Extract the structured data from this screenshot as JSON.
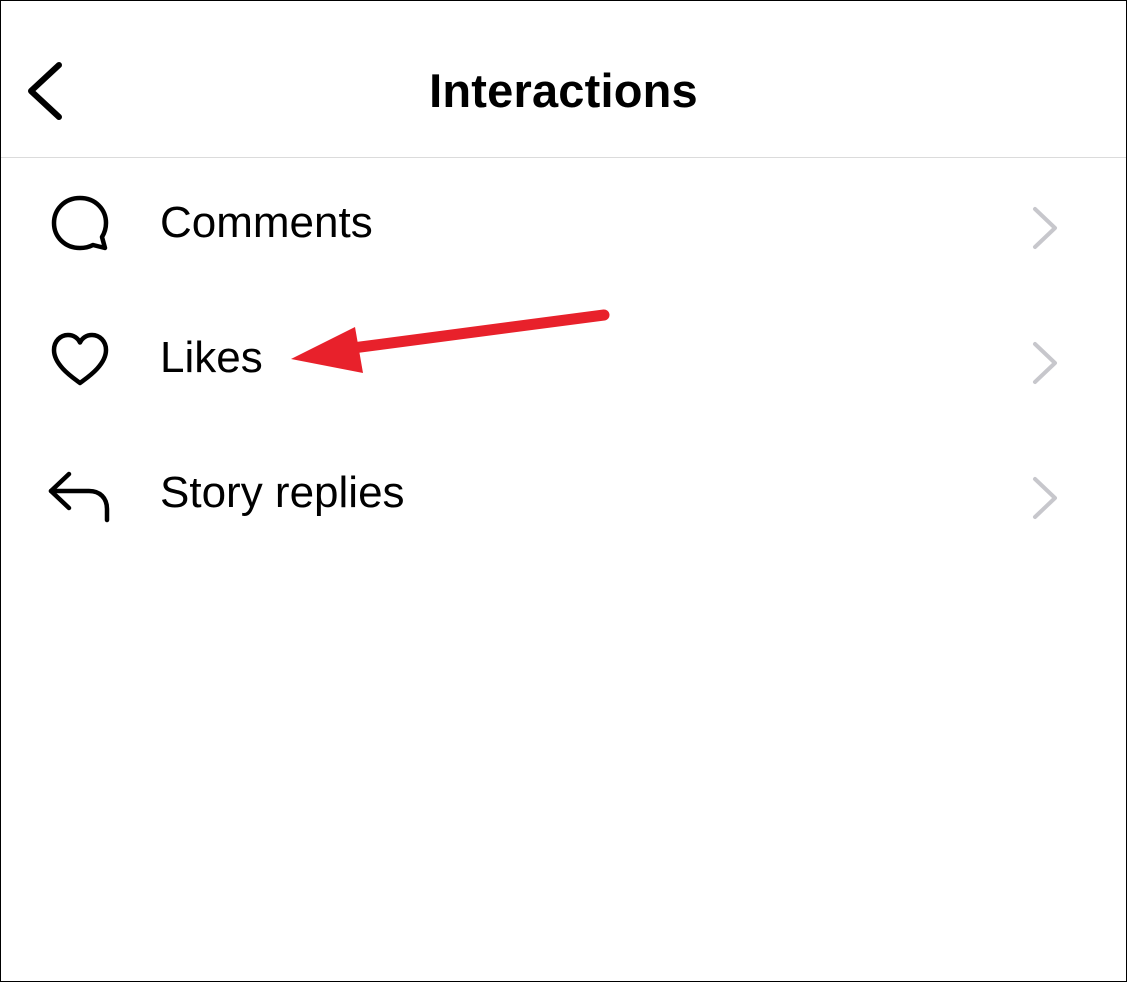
{
  "header": {
    "title": "Interactions",
    "back_icon": "chevron-left-icon"
  },
  "menu": {
    "items": [
      {
        "label": "Comments",
        "icon": "comment-bubble-icon"
      },
      {
        "label": "Likes",
        "icon": "heart-icon"
      },
      {
        "label": "Story replies",
        "icon": "reply-arrow-icon"
      }
    ],
    "trailing_icon": "chevron-right-icon"
  },
  "annotation": {
    "type": "arrow",
    "points_to": "Likes",
    "color": "#e8212b"
  },
  "colors": {
    "text": "#000000",
    "divider": "#dbdbdb",
    "chevron": "#c7c7cc",
    "background": "#ffffff"
  }
}
